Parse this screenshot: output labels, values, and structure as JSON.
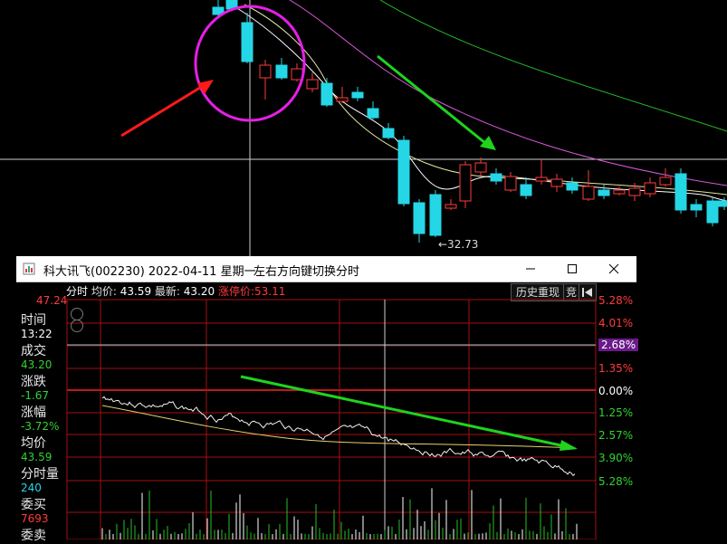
{
  "main_chart": {
    "low_price_label": "←32.73"
  },
  "window": {
    "title": "科大讯飞(002230) 2022-04-11 星期一",
    "hint": "左右方向键切换分时",
    "min_icon": "minimize-icon",
    "max_icon": "maximize-icon",
    "close_icon": "close-icon"
  },
  "infobar": {
    "mode": "分时",
    "avg_label": "均价:",
    "avg_value": "43.59",
    "latest_label": "最新:",
    "latest_value": "43.20",
    "limit_label": "涨停价:",
    "limit_value": "53.11",
    "history_button": "历史重现",
    "auction_button": "竞"
  },
  "sidebar": {
    "top_price": "47.24",
    "time_label": "时间",
    "time_value": "13:22",
    "deal_label": "成交",
    "deal_value": "43.20",
    "change_label": "涨跌",
    "change_value": "-1.67",
    "pct_label": "涨幅",
    "pct_value": "-3.72%",
    "avg_label": "均价",
    "avg_value": "43.59",
    "vol_label": "分时量",
    "vol_value": "240",
    "bid_label": "委买",
    "bid_value": "7693",
    "ask_label": "委卖"
  },
  "right_axis": {
    "labels": [
      "5.28%",
      "4.01%",
      "2.68%",
      "1.35%",
      "0.00%",
      "1.25%",
      "2.57%",
      "3.90%",
      "5.28%"
    ]
  },
  "colors": {
    "up": "#ff3b3b",
    "down": "#25d6e6",
    "arrow_green": "#1ed41e",
    "arrow_red": "#ff1a1a",
    "circle": "#e61ee6",
    "grid_red": "#a51010"
  }
}
